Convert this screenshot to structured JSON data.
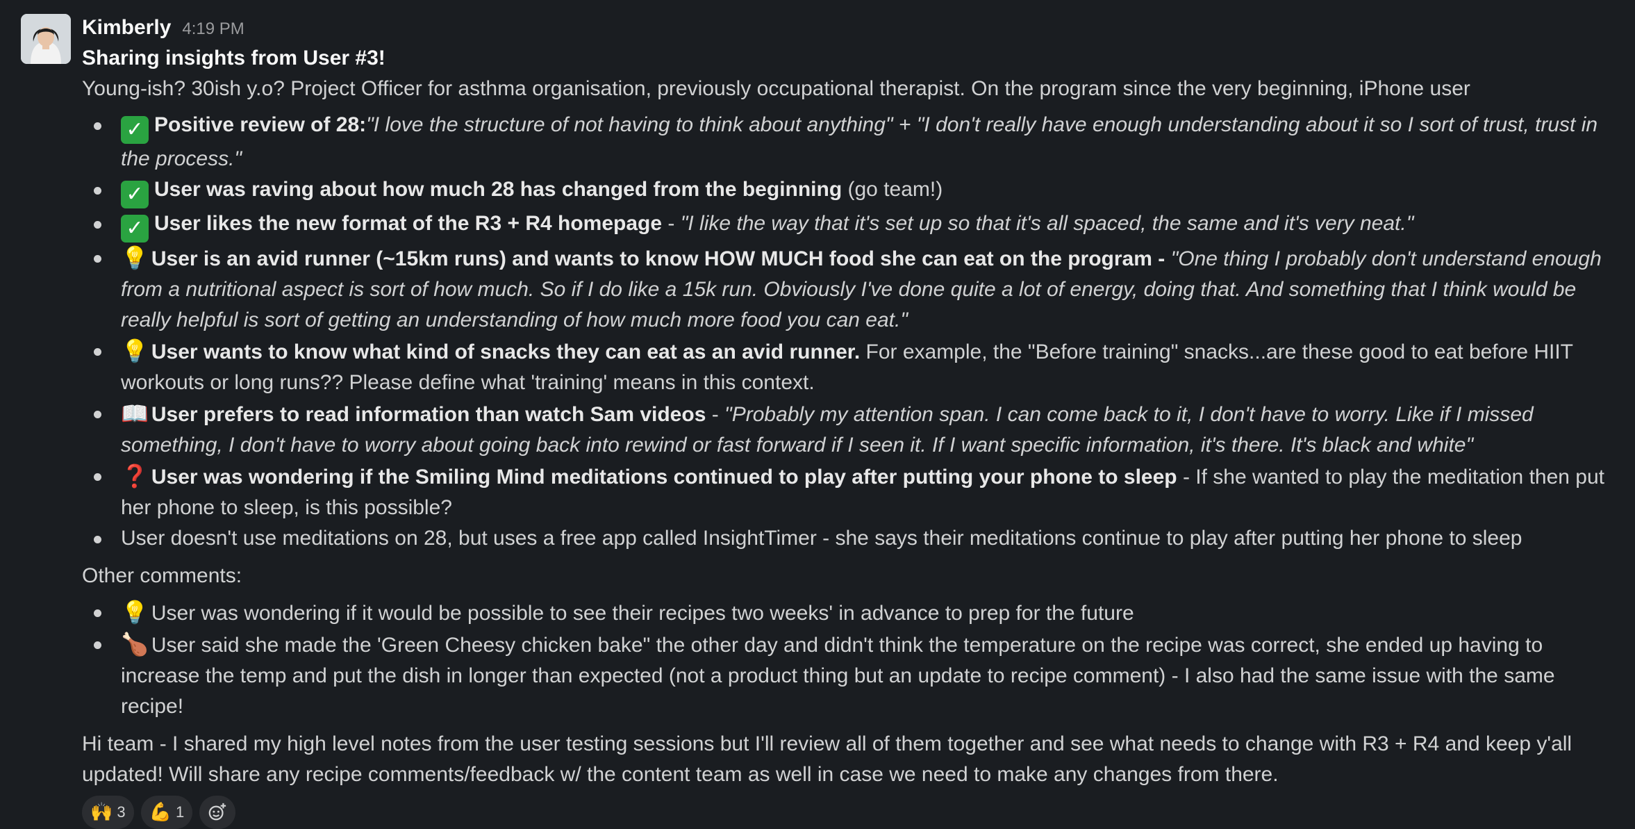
{
  "message": {
    "author": "Kimberly",
    "time": "4:19 PM",
    "title": "Sharing insights from User #3!",
    "intro": "Young-ish? 30ish y.o? Project Officer for asthma organisation, previously occupational therapist. On the program since the very beginning, iPhone user",
    "bullets": [
      {
        "emoji": "✓",
        "bold": "Positive review of 28:",
        "text": "",
        "quote": "\"I love the structure of not having to think about anything\" + \"I don't really have enough understanding about it so I sort of trust, trust in the process.\""
      },
      {
        "emoji": "✓",
        "bold": "User was raving about how much 28 has changed from the beginning",
        "text": " (go team!)",
        "quote": ""
      },
      {
        "emoji": "✓",
        "bold": "User likes the new format of the R3 + R4 homepage",
        "text": " - ",
        "quote": "\"I like the way that it's set up so that it's all spaced, the same and it's very neat.\""
      },
      {
        "emoji": "💡",
        "bold": "User is an avid runner (~15km runs) and wants to know HOW MUCH food she can eat on the program -",
        "text": " ",
        "quote": "\"One thing I probably don't understand enough from a nutritional aspect is sort of how much. So if I do like a 15k run. Obviously I've done quite a lot of energy, doing that. And something that I think would be really helpful is sort of getting an understanding of how much more food you can eat.\""
      },
      {
        "emoji": "💡",
        "bold": "User wants to know what kind of snacks they can eat as an avid runner.",
        "text": " For example, the \"Before training\" snacks...are these good to eat before HIIT workouts or long runs?? Please define what 'training' means in this context.",
        "quote": ""
      },
      {
        "emoji": "📖",
        "bold": "User prefers to read information than watch Sam videos",
        "text": " - ",
        "quote": "\"Probably my attention span. I can come back to it, I don't have to worry. Like if I missed something, I don't have to worry about going back into rewind or fast forward if I seen it. If I want specific information, it's there. It's black and white\""
      },
      {
        "emoji": "❓",
        "bold": "User was wondering if the Smiling Mind meditations continued to play after putting your phone to sleep",
        "text": " - If she wanted to play the meditation then put her phone to sleep, is this possible?",
        "quote": ""
      },
      {
        "emoji": "",
        "bold": "",
        "text": "User doesn't use meditations on 28, but uses a free app called InsightTimer - she says their meditations continue to play after putting her phone to sleep",
        "quote": ""
      }
    ],
    "other_heading": "Other comments:",
    "other_bullets": [
      {
        "emoji": "💡",
        "text": "User was wondering if it would be possible to see their recipes two weeks' in advance to prep for the future"
      },
      {
        "emoji": "🍗",
        "text": "User said she made the 'Green Cheesy chicken bake\" the other day and didn't think the temperature on the recipe was correct, she ended up having to increase the temp and put the dish in longer than expected (not a product thing but an update to recipe comment) - I also had the same issue with the same recipe!"
      }
    ],
    "closing": "Hi team - I shared my high level notes from the user testing sessions but I'll review all of them together and see what needs to change with R3 + R4 and keep y'all updated! Will share any recipe comments/feedback w/ the content team as well in case we need to make any changes from there."
  },
  "reactions": [
    {
      "emoji": "🙌",
      "count": "3"
    },
    {
      "emoji": "💪",
      "count": "1"
    }
  ],
  "icons": {
    "add_reaction": "add-reaction-icon",
    "avatar": "user-avatar"
  },
  "colors": {
    "background": "#1a1d21",
    "text": "#d1d2d3",
    "check": "#2aa341"
  }
}
